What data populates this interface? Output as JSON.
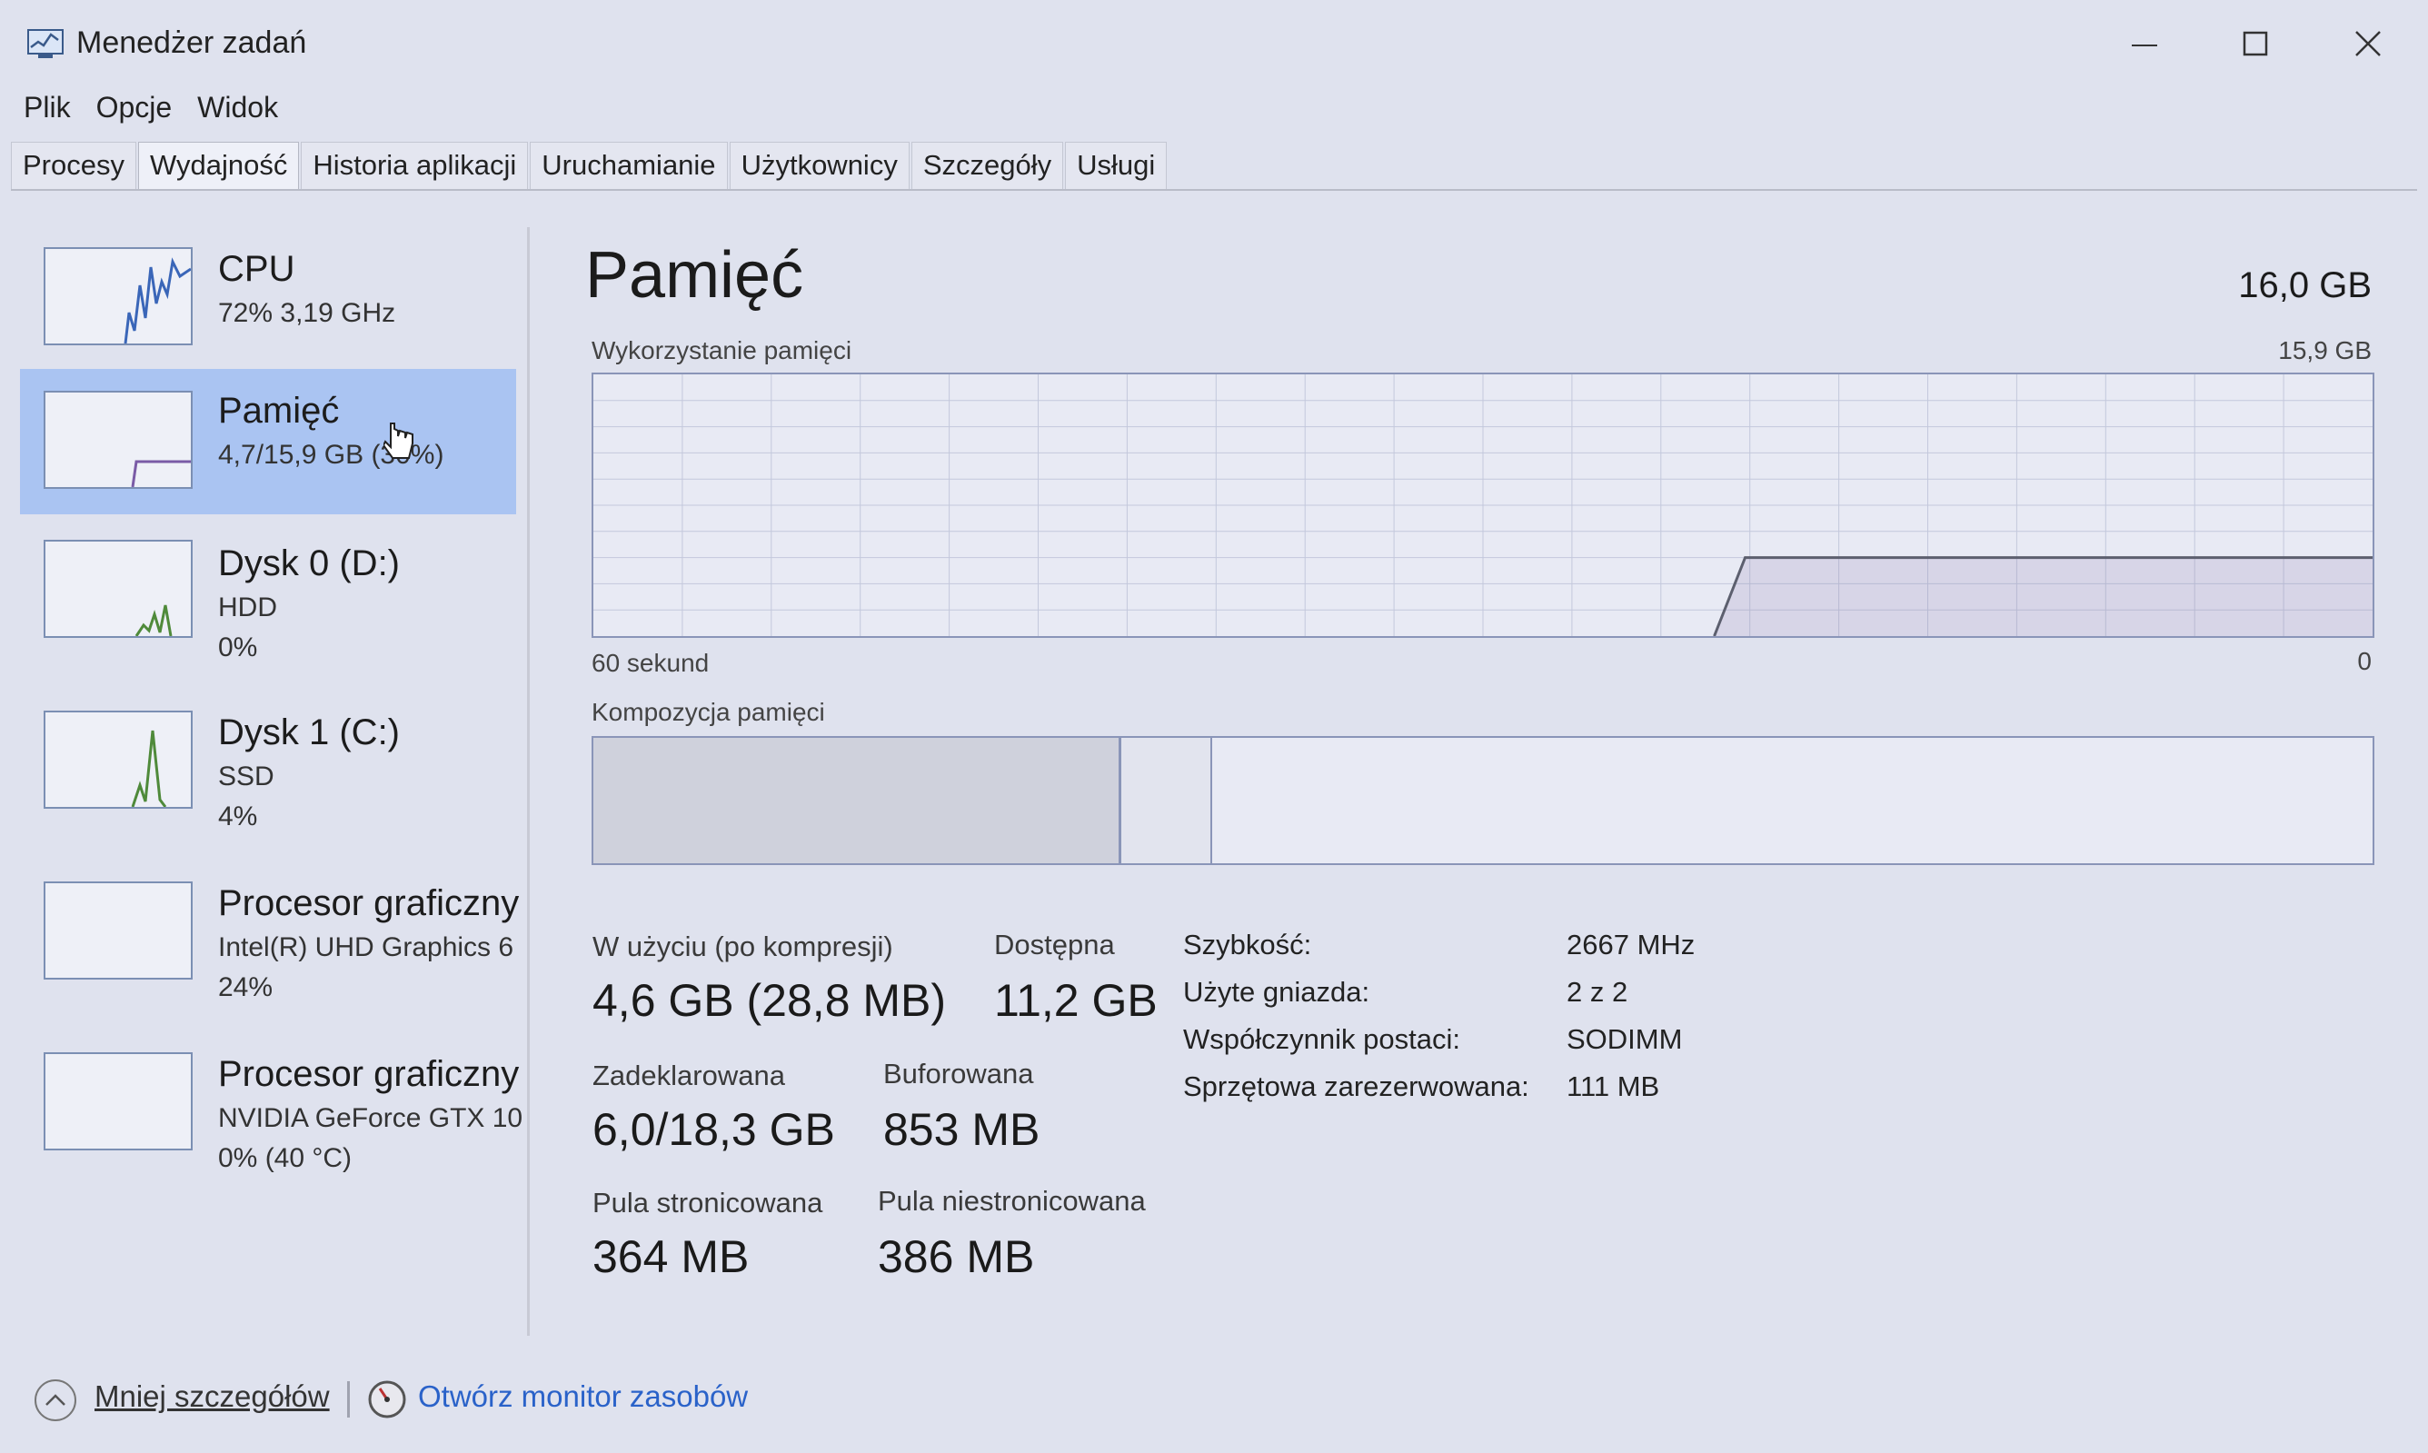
{
  "window": {
    "title": "Menedżer zadań"
  },
  "menu": [
    "Plik",
    "Opcje",
    "Widok"
  ],
  "tabs": [
    "Procesy",
    "Wydajność",
    "Historia aplikacji",
    "Uruchamianie",
    "Użytkownicy",
    "Szczegóły",
    "Usługi"
  ],
  "active_tab": "Wydajność",
  "sidebar": {
    "items": [
      {
        "title": "CPU",
        "line1": "72% 3,19 GHz",
        "line2": ""
      },
      {
        "title": "Pamięć",
        "line1": "4,7/15,9 GB (30%)",
        "line2": ""
      },
      {
        "title": "Dysk 0 (D:)",
        "line1": "HDD",
        "line2": "0%"
      },
      {
        "title": "Dysk 1 (C:)",
        "line1": "SSD",
        "line2": "4%"
      },
      {
        "title": "Procesor graficzny",
        "line1": "Intel(R) UHD Graphics 6",
        "line2": "24%"
      },
      {
        "title": "Procesor graficzny",
        "line1": "NVIDIA GeForce GTX 10",
        "line2": "0% (40 °C)"
      }
    ],
    "selected": "Pamięć"
  },
  "main": {
    "title": "Pamięć",
    "total": "16,0 GB",
    "usage_label": "Wykorzystanie pamięci",
    "usage_max": "15,9 GB",
    "time_left": "60 sekund",
    "time_right": "0",
    "composition_label": "Kompozycja pamięci",
    "composition": {
      "in_use_fraction": 0.295,
      "modified_fraction": 0.05
    },
    "usage_history": {
      "flat_fraction_of_window": 0.63,
      "level_fraction": 0.3
    }
  },
  "stats": {
    "in_use_label": "W użyciu (po kompresji)",
    "in_use_value": "4,6 GB (28,8 MB)",
    "available_label": "Dostępna",
    "available_value": "11,2 GB",
    "committed_label": "Zadeklarowana",
    "committed_value": "6,0/18,3 GB",
    "cached_label": "Buforowana",
    "cached_value": "853 MB",
    "paged_label": "Pula stronicowana",
    "paged_value": "364 MB",
    "nonpaged_label": "Pula niestronicowana",
    "nonpaged_value": "386 MB"
  },
  "specs": [
    {
      "label": "Szybkość:",
      "value": "2667 MHz"
    },
    {
      "label": "Użyte gniazda:",
      "value": "2 z 2"
    },
    {
      "label": "Współczynnik postaci:",
      "value": "SODIMM"
    },
    {
      "label": "Sprzętowa zarezerwowana:",
      "value": "111 MB"
    }
  ],
  "footer": {
    "less_details": "Mniej szczegółów",
    "open_monitor": "Otwórz monitor zasobów"
  },
  "colors": {
    "window_bg": "#dfe2ee",
    "selected_bg": "#aac4f2",
    "graph_line": "#5c5f6e",
    "link": "#2a62c9"
  }
}
